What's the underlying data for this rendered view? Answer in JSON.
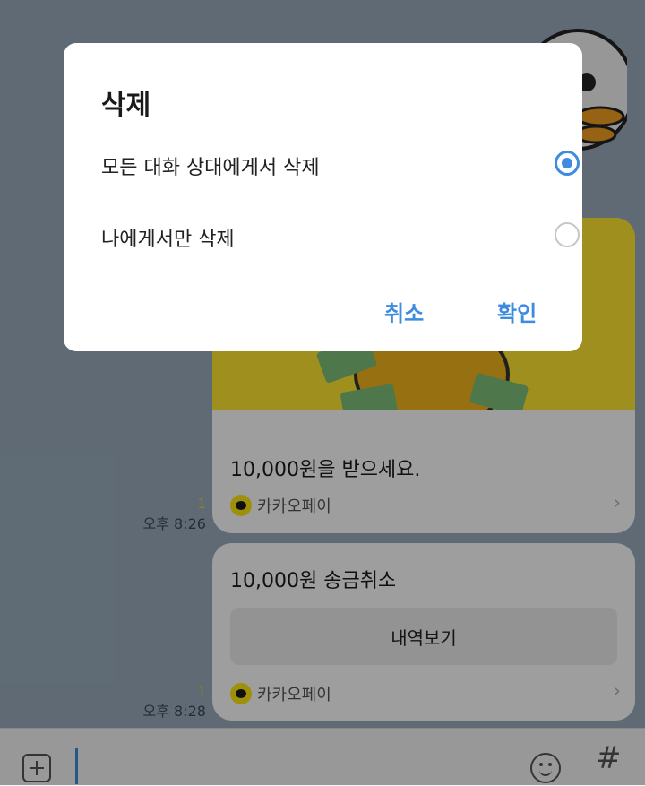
{
  "dialog": {
    "title": "삭제",
    "options": [
      {
        "label": "모든 대화 상대에게서 삭제",
        "selected": true
      },
      {
        "label": "나에게서만 삭제",
        "selected": false
      }
    ],
    "cancel_label": "취소",
    "confirm_label": "확인",
    "accent_color": "#3d8ce0"
  },
  "messages": [
    {
      "title": "10,000원을 받으세요.",
      "service": "카카오페이",
      "unread": "1",
      "time": "오후 8:26"
    },
    {
      "title": "10,000원 송금취소",
      "button_label": "내역보기",
      "service": "카카오페이",
      "unread": "1",
      "time": "오후 8:28"
    }
  ],
  "input_bar": {
    "add_icon": "plus-box-icon",
    "emoji_icon": "smiley-icon",
    "hashtag_label": "#"
  }
}
